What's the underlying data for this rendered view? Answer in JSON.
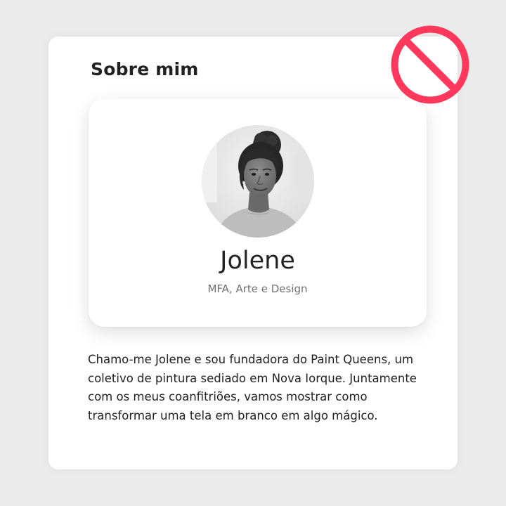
{
  "about_section": {
    "title": "Sobre mim"
  },
  "profile": {
    "name": "Jolene",
    "subtitle": "MFA, Arte e Design",
    "avatar_icon": "person-portrait-photo"
  },
  "bio": {
    "text": "Chamo-me Jolene e sou fundadora do Paint Queens, um coletivo de pintura sediado em Nova Iorque. Juntamente com os meus coanfitriões, vamos mostrar como transformar uma tela em branco em algo mágico."
  },
  "prohibited_sign": {
    "icon": "no-entry-icon",
    "color": "#ff385c"
  },
  "colors": {
    "background": "#ebebeb",
    "card": "#ffffff",
    "text_primary": "#222222",
    "text_secondary": "#717171",
    "accent": "#ff385c"
  }
}
